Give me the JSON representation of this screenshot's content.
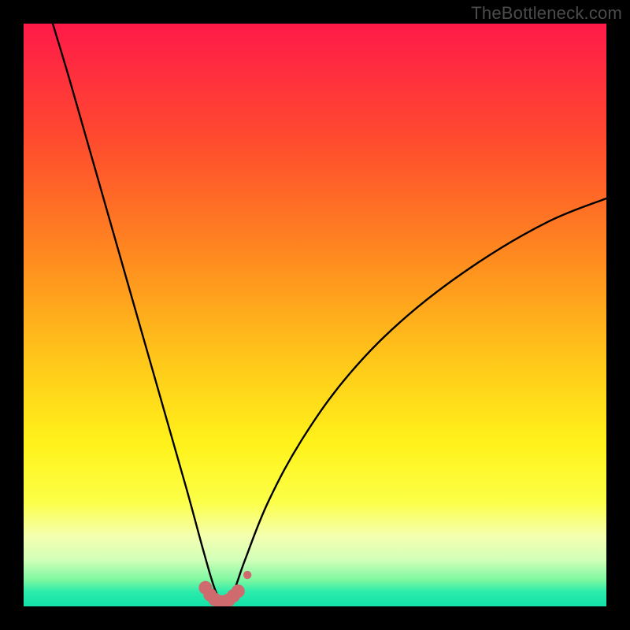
{
  "watermark": "TheBottleneck.com",
  "colors": {
    "frame": "#000000",
    "watermark": "#4b4b4b",
    "curve": "#000000",
    "marker_fill": "#cf6a6e",
    "gradient_stops": [
      {
        "offset": 0.0,
        "color": "#ff1a49"
      },
      {
        "offset": 0.2,
        "color": "#ff4b2e"
      },
      {
        "offset": 0.4,
        "color": "#ff8a1f"
      },
      {
        "offset": 0.58,
        "color": "#ffc81a"
      },
      {
        "offset": 0.72,
        "color": "#fff21a"
      },
      {
        "offset": 0.82,
        "color": "#fcff47"
      },
      {
        "offset": 0.88,
        "color": "#f4ffb0"
      },
      {
        "offset": 0.92,
        "color": "#d2ffb9"
      },
      {
        "offset": 0.955,
        "color": "#7cf7a0"
      },
      {
        "offset": 0.975,
        "color": "#2becac"
      },
      {
        "offset": 1.0,
        "color": "#13e0a8"
      }
    ]
  },
  "chart_data": {
    "type": "line",
    "title": "",
    "xlabel": "",
    "ylabel": "",
    "xlim": [
      0,
      100
    ],
    "ylim": [
      0,
      100
    ],
    "note": "Bottleneck-style curve. y ≈ 100 at x≈5, drops to ~0 around x≈33–36, rises to ~70 at x≈100. Values read off chart geometry (axes unlabeled).",
    "series": [
      {
        "name": "bottleneck-curve",
        "x": [
          5,
          8,
          12,
          16,
          20,
          24,
          28,
          31,
          33,
          34.5,
          36,
          38,
          42,
          48,
          56,
          66,
          78,
          90,
          100
        ],
        "y": [
          100,
          90,
          76,
          62,
          48,
          34,
          20,
          9,
          2.5,
          0.8,
          2.5,
          8,
          18,
          29,
          40,
          50,
          59,
          66,
          70
        ]
      }
    ],
    "markers": {
      "name": "trough-markers",
      "x": [
        31.2,
        32.0,
        32.8,
        33.6,
        34.4,
        35.2,
        36.0,
        36.8,
        38.4
      ],
      "y": [
        3.2,
        2.0,
        1.2,
        0.8,
        0.8,
        1.1,
        1.8,
        2.6,
        5.4
      ],
      "r": [
        1.15,
        1.15,
        1.15,
        1.15,
        1.15,
        1.15,
        1.15,
        1.15,
        0.7
      ]
    }
  }
}
